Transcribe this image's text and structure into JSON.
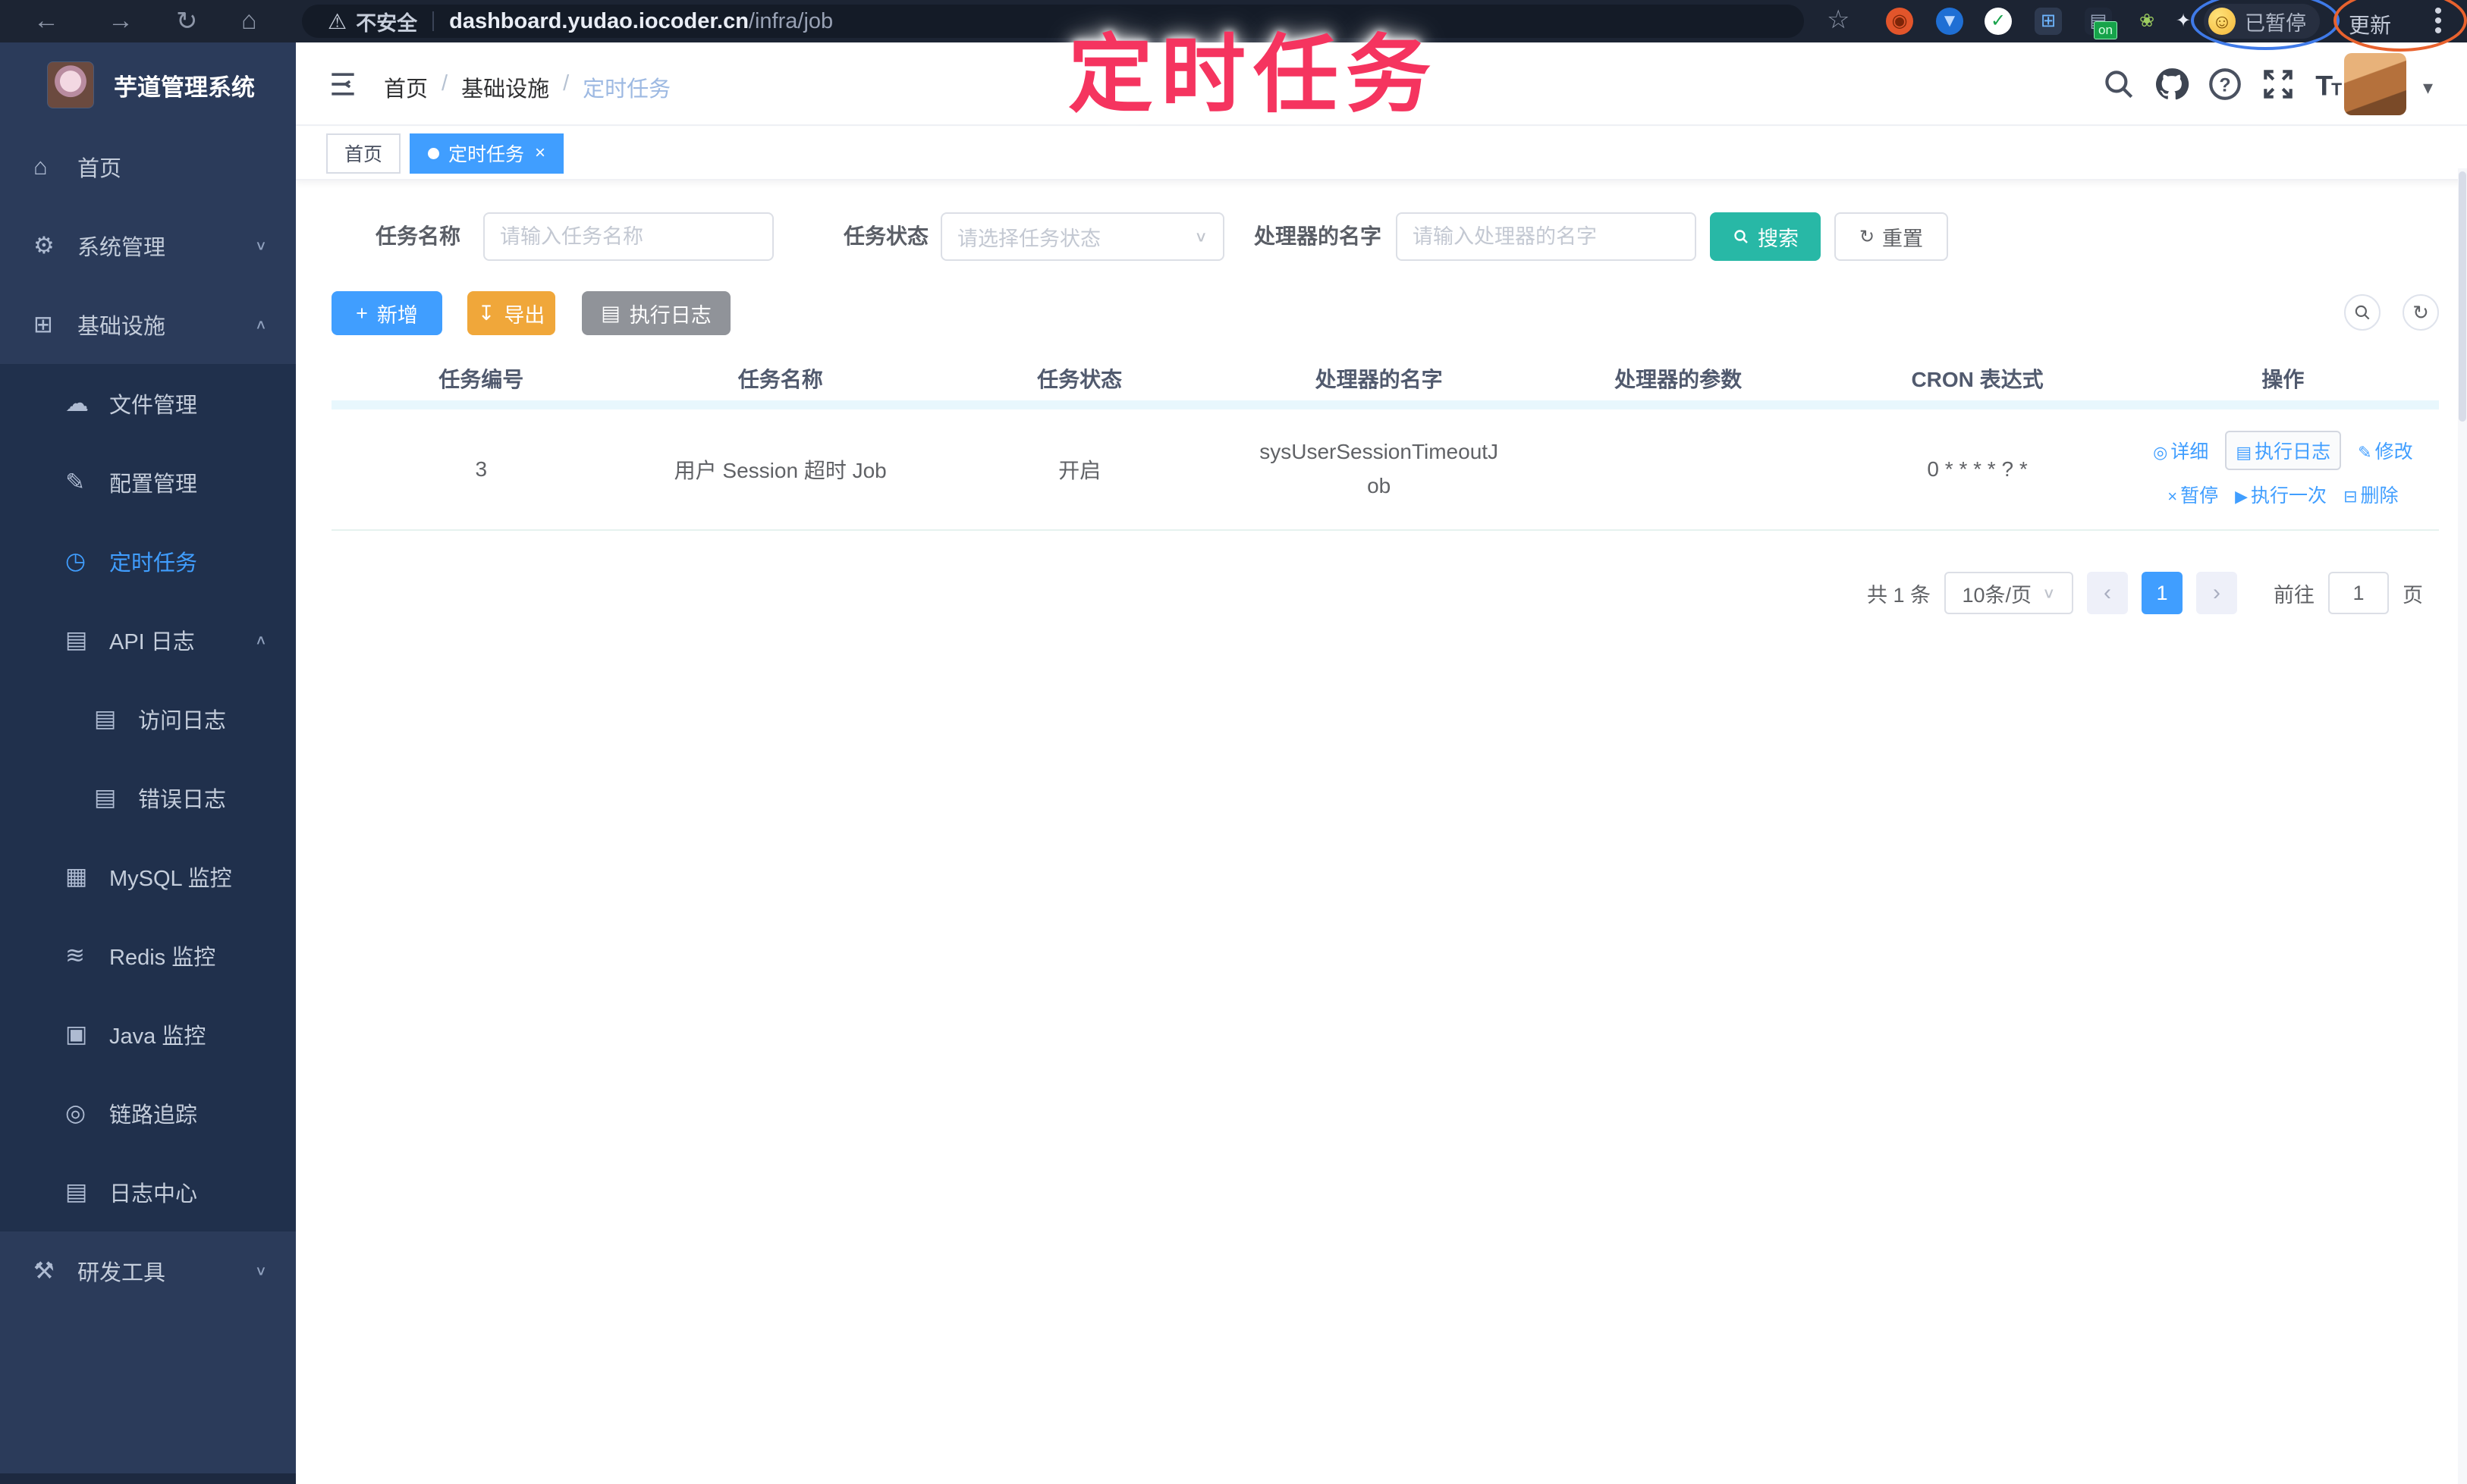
{
  "annotation": {
    "title": "定时任务",
    "color": "#f5345f"
  },
  "browser": {
    "security": "不安全",
    "host": "dashboard.yudao.iocoder.cn",
    "path": "/infra/job",
    "paused": "已暂停",
    "update": "更新",
    "ext_on_badge": "on"
  },
  "sidebar": {
    "title": "芋道管理系统",
    "items": [
      {
        "key": "home",
        "label": "首页",
        "icon": "home",
        "level": 1
      },
      {
        "key": "system",
        "label": "系统管理",
        "icon": "gear",
        "level": 1,
        "chevron": "down"
      },
      {
        "key": "infra",
        "label": "基础设施",
        "icon": "grid",
        "level": 1,
        "chevron": "up"
      },
      {
        "key": "file",
        "label": "文件管理",
        "icon": "cloud",
        "level": 2,
        "dark": true
      },
      {
        "key": "config",
        "label": "配置管理",
        "icon": "edit",
        "level": 2,
        "dark": true
      },
      {
        "key": "job",
        "label": "定时任务",
        "icon": "clock",
        "level": 2,
        "dark": true,
        "active": true
      },
      {
        "key": "api-log",
        "label": "API 日志",
        "icon": "log",
        "level": 2,
        "dark": true,
        "chevron": "up"
      },
      {
        "key": "access-log",
        "label": "访问日志",
        "icon": "log",
        "level": 3,
        "dark": true
      },
      {
        "key": "error-log",
        "label": "错误日志",
        "icon": "log",
        "level": 3,
        "dark": true
      },
      {
        "key": "mysql",
        "label": "MySQL 监控",
        "icon": "db",
        "level": 2,
        "dark": true
      },
      {
        "key": "redis",
        "label": "Redis 监控",
        "icon": "layers",
        "level": 2,
        "dark": true
      },
      {
        "key": "java",
        "label": "Java 监控",
        "icon": "screen",
        "level": 2,
        "dark": true
      },
      {
        "key": "trace",
        "label": "链路追踪",
        "icon": "eye",
        "level": 2,
        "dark": true
      },
      {
        "key": "log-center",
        "label": "日志中心",
        "icon": "log",
        "level": 2,
        "dark": true
      },
      {
        "key": "dev-tools",
        "label": "研发工具",
        "icon": "tools",
        "level": 1,
        "chevron": "down"
      }
    ]
  },
  "header": {
    "breadcrumb": [
      "首页",
      "基础设施",
      "定时任务"
    ]
  },
  "tabs": [
    {
      "label": "首页",
      "active": false
    },
    {
      "label": "定时任务",
      "active": true,
      "closable": true
    }
  ],
  "filters": {
    "name_label": "任务名称",
    "name_placeholder": "请输入任务名称",
    "status_label": "任务状态",
    "status_placeholder": "请选择任务状态",
    "handler_label": "处理器的名字",
    "handler_placeholder": "请输入处理器的名字",
    "search_label": "搜索",
    "reset_label": "重置"
  },
  "toolbar": {
    "add_label": "新增",
    "export_label": "导出",
    "exec_log_label": "执行日志"
  },
  "table": {
    "columns": [
      "任务编号",
      "任务名称",
      "任务状态",
      "处理器的名字",
      "处理器的参数",
      "CRON 表达式",
      "操作"
    ],
    "rows": [
      {
        "id": "3",
        "name": "用户 Session 超时 Job",
        "status": "开启",
        "handler": "sysUserSessionTimeoutJob",
        "param": "",
        "cron": "0 * * * * ? *",
        "actions1": [
          "详细",
          "执行日志",
          "修改"
        ],
        "actions2": [
          "暂停",
          "执行一次",
          "删除"
        ]
      }
    ]
  },
  "pagination": {
    "total": "共 1 条",
    "page_size": "10条/页",
    "current_page": "1",
    "goto_label": "前往",
    "goto_value": "1",
    "page_unit": "页"
  },
  "colors": {
    "accent": "#409eff",
    "search_btn": "#28b8a6",
    "export_btn": "#f0a73a",
    "info_btn": "#909399"
  }
}
